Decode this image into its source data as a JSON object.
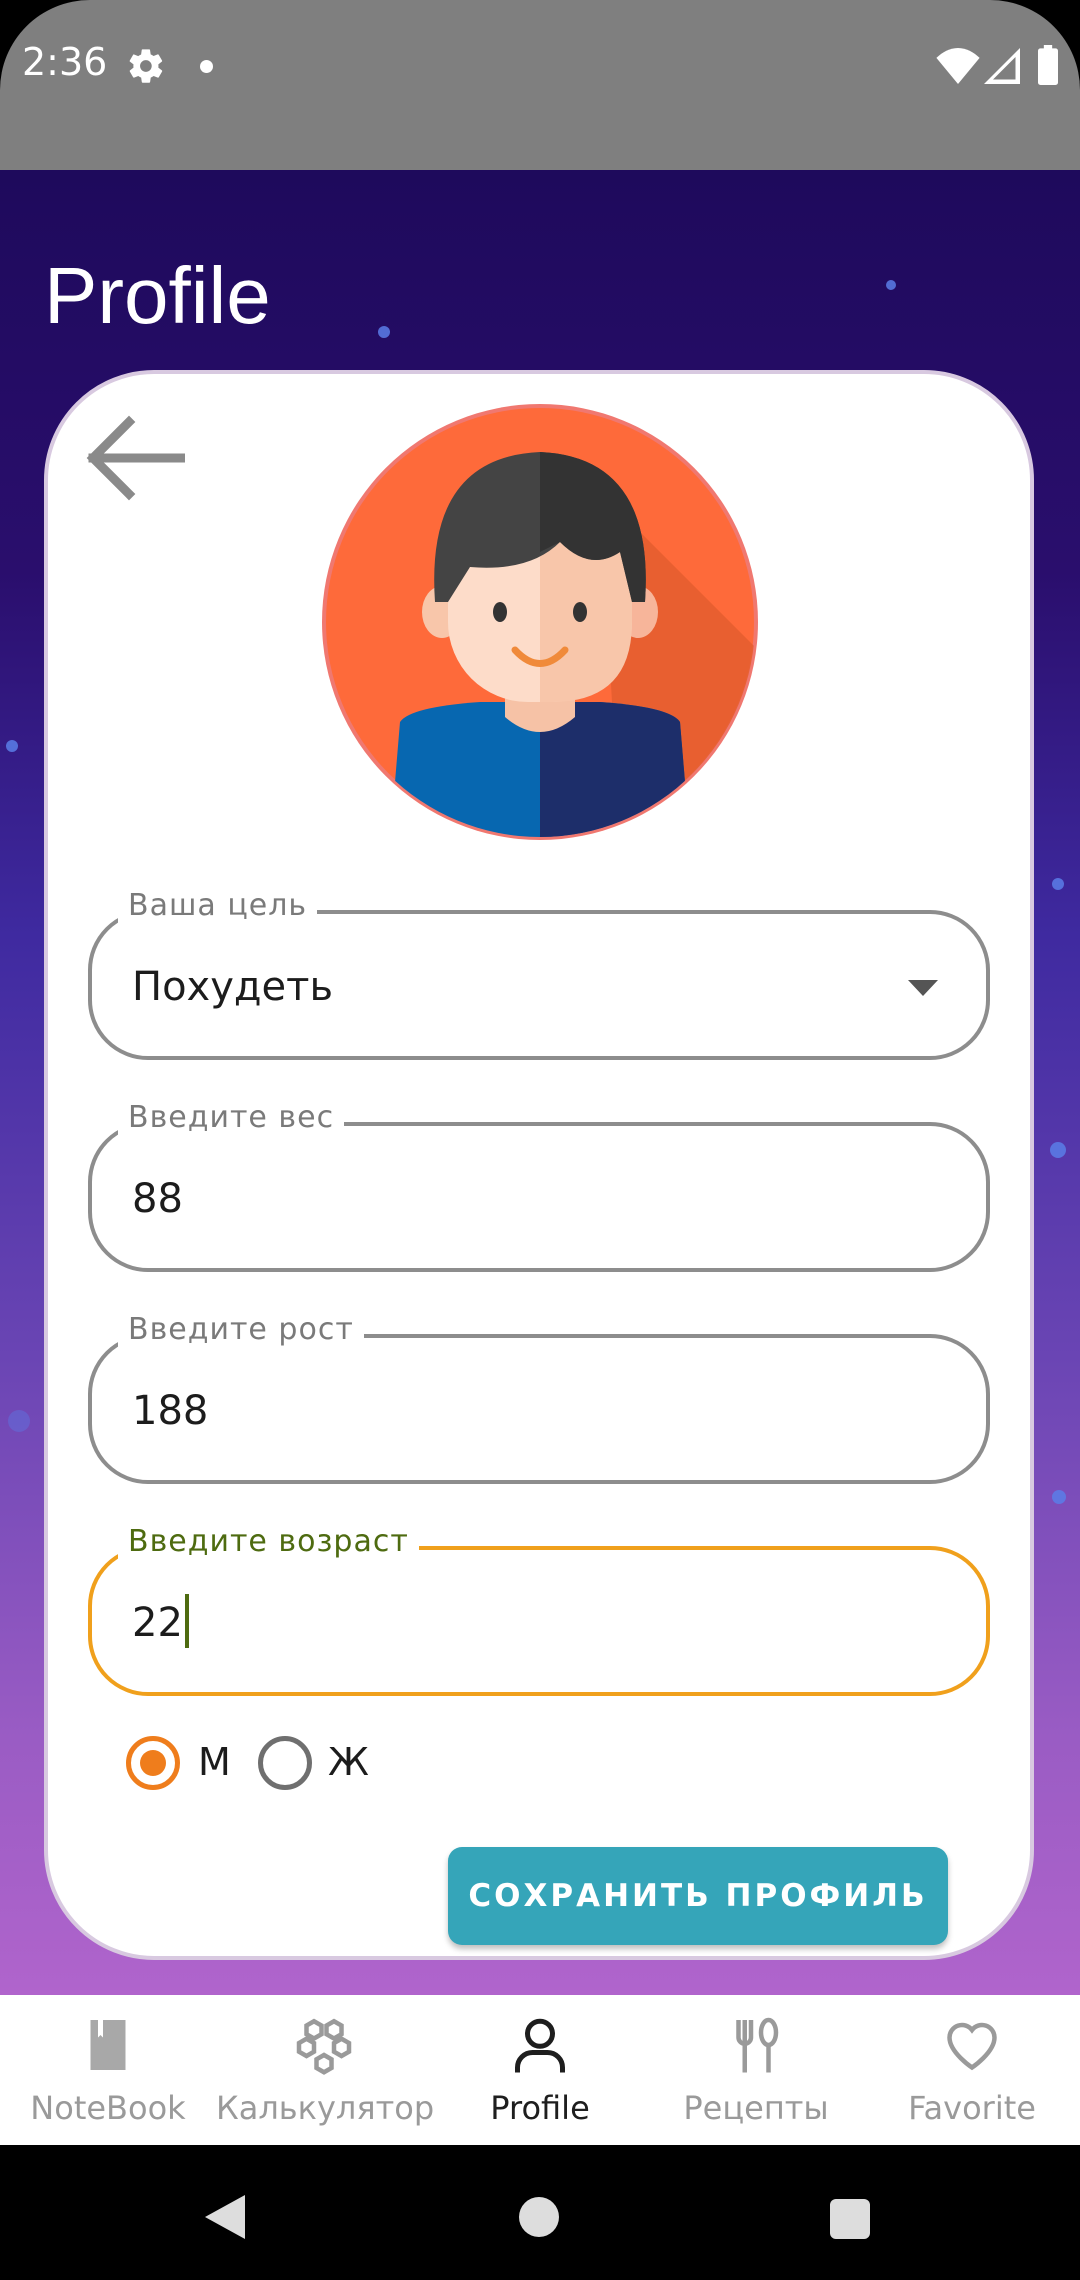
{
  "status_bar": {
    "time": "2:36"
  },
  "page": {
    "title": "Profile"
  },
  "form": {
    "goal": {
      "label": "Ваша цель",
      "value": "Похудеть"
    },
    "weight": {
      "label": "Введите вес",
      "value": "88"
    },
    "height": {
      "label": "Введите рост",
      "value": "188"
    },
    "age": {
      "label": "Введите возраст",
      "value": "22"
    },
    "gender": {
      "options": [
        {
          "label": "М",
          "selected": true
        },
        {
          "label": "Ж",
          "selected": false
        }
      ]
    },
    "save_label": "СОХРАНИТЬ ПРОФИЛЬ"
  },
  "bottom_nav": {
    "items": [
      {
        "label": "NoteBook",
        "icon": "book-icon",
        "active": false
      },
      {
        "label": "Калькулятор",
        "icon": "hexagons-icon",
        "active": false
      },
      {
        "label": "Profile",
        "icon": "person-icon",
        "active": true
      },
      {
        "label": "Рецепты",
        "icon": "fork-spoon-icon",
        "active": false
      },
      {
        "label": "Favorite",
        "icon": "heart-icon",
        "active": false
      }
    ]
  },
  "colors": {
    "accent_orange": "#ef7d1c",
    "focused_border": "#f0a01c",
    "save_button": "#35a5b9",
    "header_dark": "#1e0a5c"
  }
}
